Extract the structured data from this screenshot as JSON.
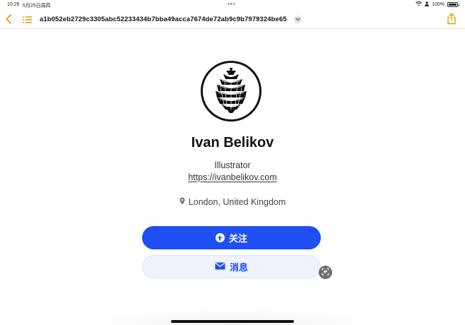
{
  "status_bar": {
    "time": "10:26",
    "date": "5月25日周四",
    "dots": "•••",
    "battery": "100%"
  },
  "toolbar": {
    "document_title": "a1b052eb2729c3305abc52233434b7bba49acca7674de72ab9c9b7979324be65",
    "accent_color": "#e0a100"
  },
  "profile": {
    "name": "Ivan Belikov",
    "role": "Illustrator",
    "website": "https://ivanbelikov.com",
    "location": "London, United Kingdom",
    "avatar_icon": "pinecone-icon"
  },
  "actions": {
    "follow_label": "关注",
    "message_label": "消息",
    "primary_color": "#1f4ff2"
  }
}
